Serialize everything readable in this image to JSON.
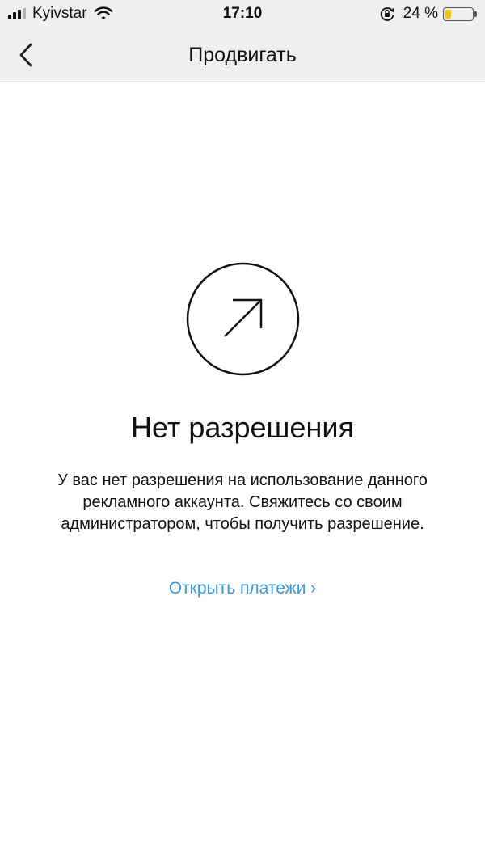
{
  "status_bar": {
    "carrier": "Kyivstar",
    "time": "17:10",
    "battery_percent": "24 %",
    "battery_level": 0.24,
    "icons": [
      "signal-icon",
      "wifi-icon",
      "rotation-lock-icon",
      "battery-icon"
    ]
  },
  "nav": {
    "title": "Продвигать",
    "back_icon": "chevron-left-icon"
  },
  "empty_state": {
    "icon": "arrow-up-right-circle-icon",
    "title": "Нет разрешения",
    "description": "У вас нет разрешения на использование данного рекламного аккаунта. Свяжитесь со своим администратором, чтобы получить разрешение.",
    "link_label": "Открыть платежи ›"
  },
  "colors": {
    "link": "#3e97da",
    "bar_background": "#efefef",
    "battery_fill": "#f5c400"
  }
}
